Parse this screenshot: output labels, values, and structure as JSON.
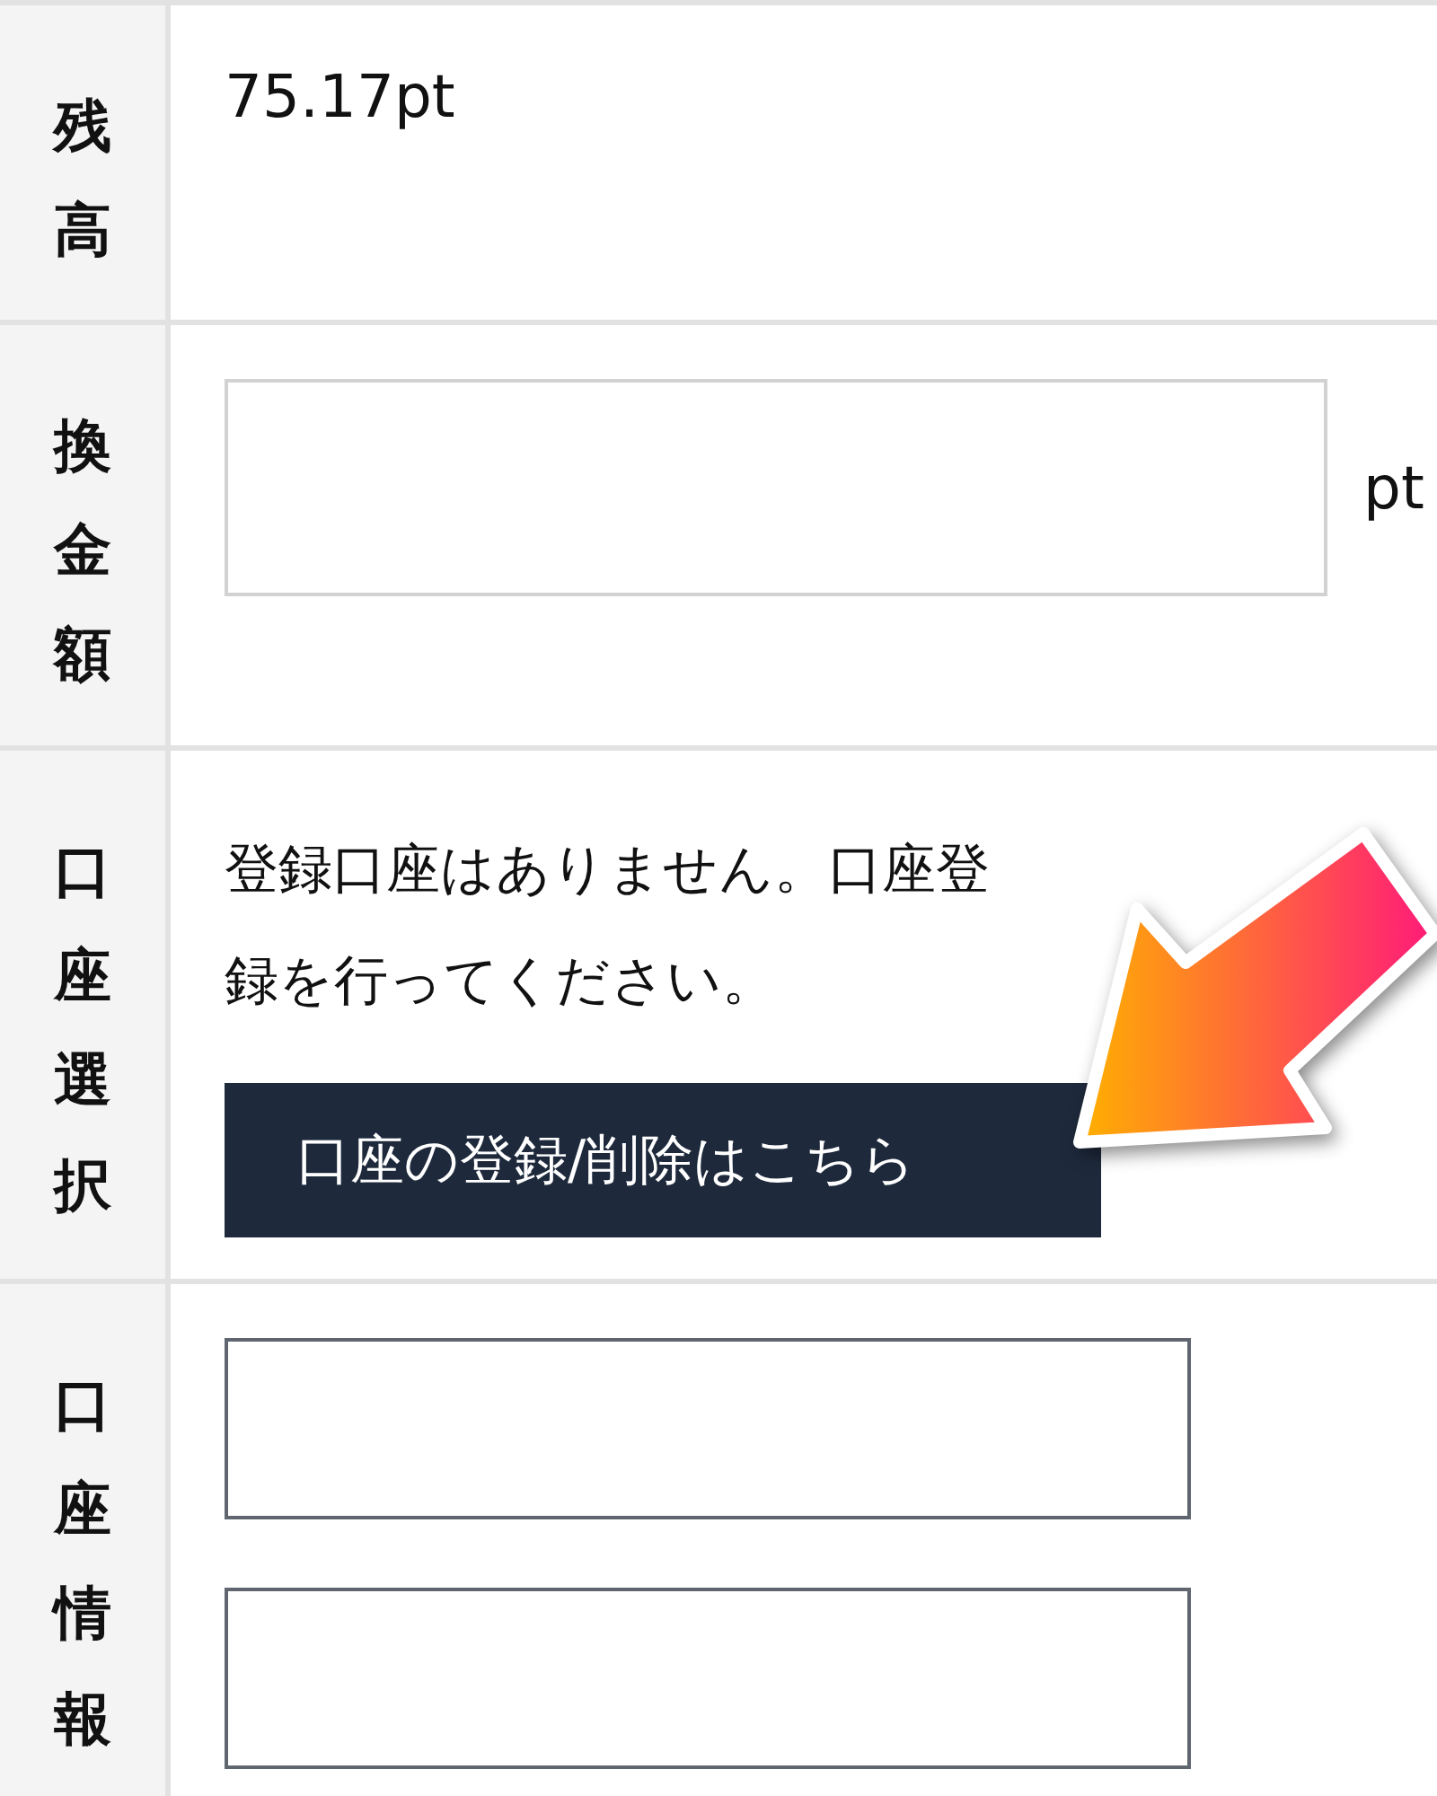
{
  "rows": [
    {
      "kind": "value",
      "label": "残高",
      "value": "75.17pt"
    },
    {
      "kind": "amount",
      "label": "換金額",
      "unit": "pt"
    },
    {
      "kind": "account_select",
      "label": "口座選択",
      "message": "登録口座はありません。口座登録を行ってください。",
      "button": "口座の登録/削除はこちら"
    },
    {
      "kind": "account_info",
      "label": "口座情報",
      "fields": [
        {
          "kind": "text_input"
        },
        {
          "kind": "text_input"
        }
      ]
    }
  ]
}
